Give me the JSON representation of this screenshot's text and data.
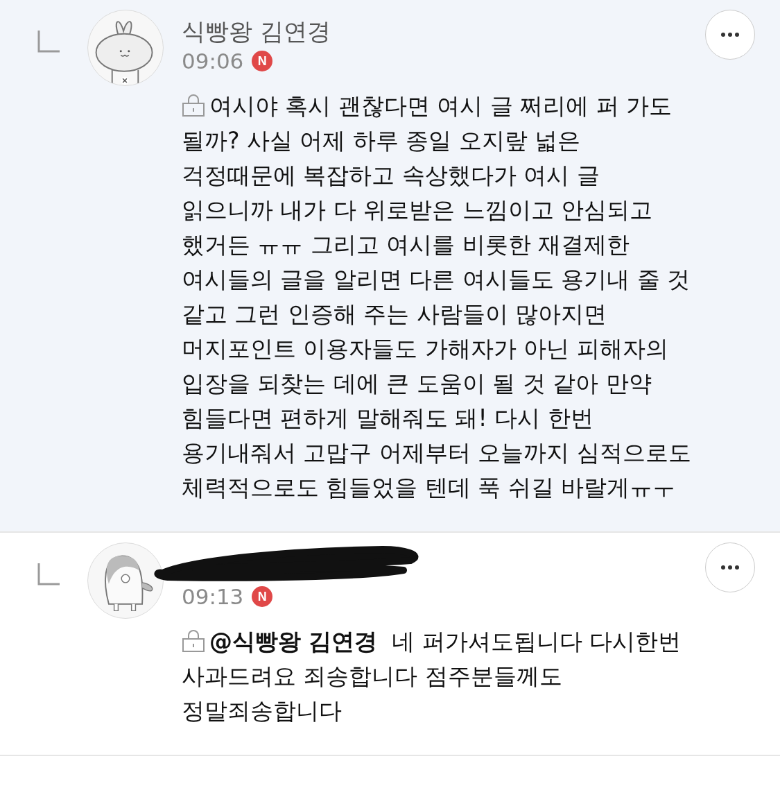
{
  "comments": [
    {
      "author": "식빵왕 김연경",
      "author_redacted": false,
      "time": "09:06",
      "badge": "N",
      "highlighted": true,
      "locked": true,
      "text": "여시야 혹시 괜찮다면 여시 글 쩌리에 퍼 가도\n될까? 사실 어제 하루 종일 오지랖 넓은\n걱정때문에 복잡하고 속상했다가 여시 글\n읽으니까 내가 다 위로받은 느낌이고 안심되고\n했거든 ㅠㅠ 그리고 여시를 비롯한 재결제한\n여시들의 글을 알리면 다른 여시들도 용기내 줄 것\n같고 그런 인증해 주는 사람들이 많아지면\n머지포인트 이용자들도 가해자가 아닌 피해자의\n입장을 되찾는 데에 큰 도움이 될 것 같아 만약\n힘들다면 편하게 말해줘도 돼! 다시 한번\n용기내줘서 고맙구 어제부터 오늘까지 심적으로도\n체력적으로도 힘들었을 텐데 푹 쉬길 바랄게ㅠㅜ"
    },
    {
      "author_redacted": true,
      "time": "09:13",
      "badge": "N",
      "highlighted": false,
      "locked": true,
      "text": "**@식빵왕 김연경**  네 퍼가셔도됩니다 다시한번\n사과드려요 죄송합니다 점주분들께도\n정말죄송합니다"
    }
  ]
}
